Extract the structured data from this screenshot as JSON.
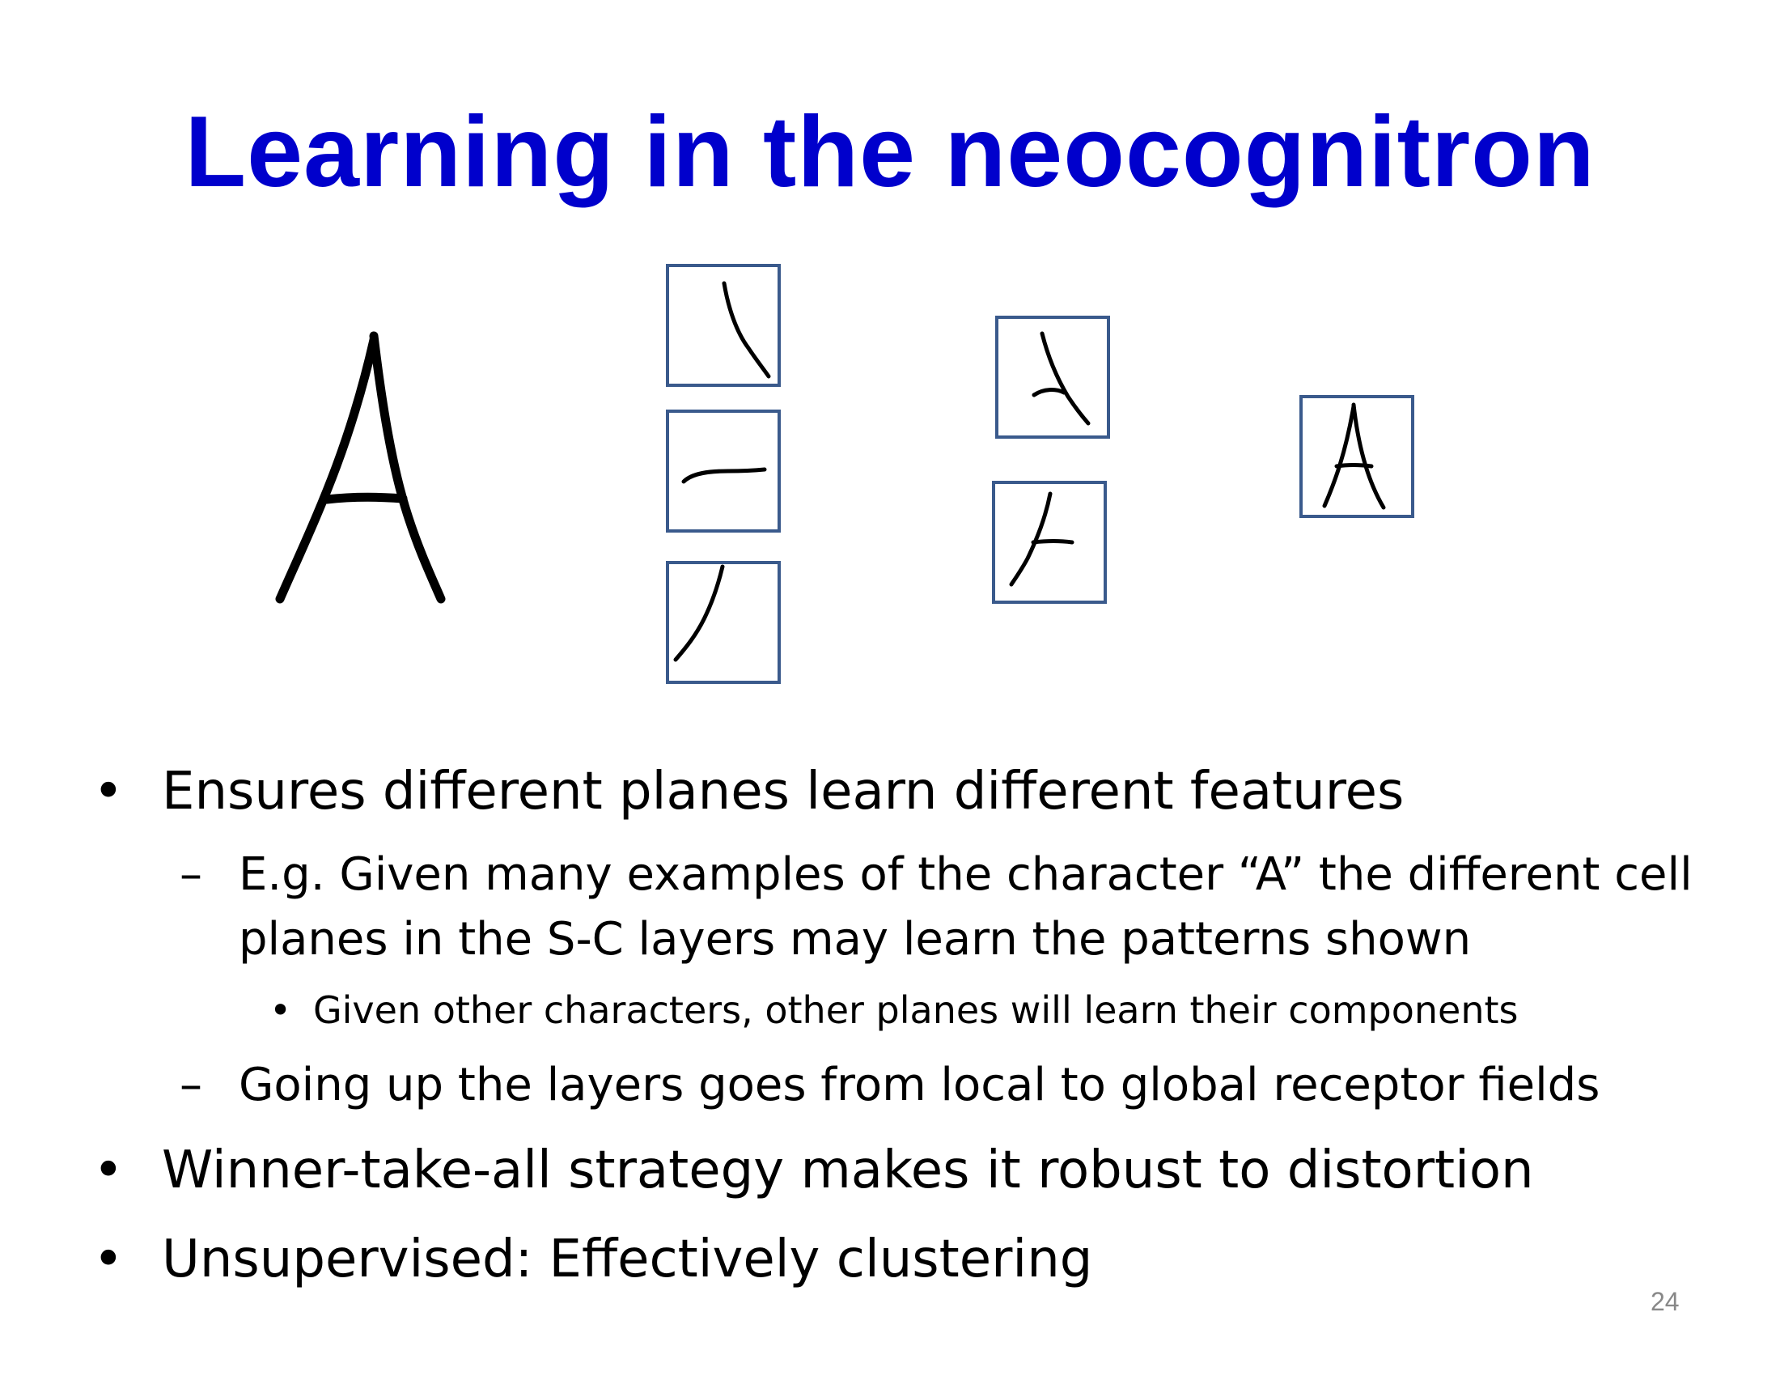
{
  "title": "Learning in the neocognitron",
  "bullets": [
    {
      "level": 1,
      "text": "Ensures different planes learn different features"
    },
    {
      "level": 2,
      "marker": "–",
      "text_line1": "E.g.  Given many examples of the character “A” the different cell",
      "text_line2": "planes in the S-C layers may learn the patterns shown"
    },
    {
      "level": 3,
      "text": "Given other characters, other planes will learn their components"
    },
    {
      "level": 2,
      "marker": "–",
      "text": "Going up the layers goes from local to global receptor fields"
    },
    {
      "level": 1,
      "text": "Winner-take-all strategy makes it robust to distortion"
    },
    {
      "level": 1,
      "text": "Unsupervised: Effectively clustering"
    }
  ],
  "bullet_symbol": "•",
  "page_number": "24",
  "colors": {
    "title": "#0000cc",
    "box_border": "#3a5a8c",
    "stroke": "#000000",
    "page_number": "#888888"
  },
  "figure": {
    "input_character": "handwritten-A",
    "layer1_features": [
      "right-diagonal-stroke",
      "horizontal-stroke",
      "left-diagonal-stroke"
    ],
    "layer2_features": [
      "right-apex-junction",
      "left-crossbar-junction"
    ],
    "layer3_features": [
      "full-A"
    ]
  }
}
